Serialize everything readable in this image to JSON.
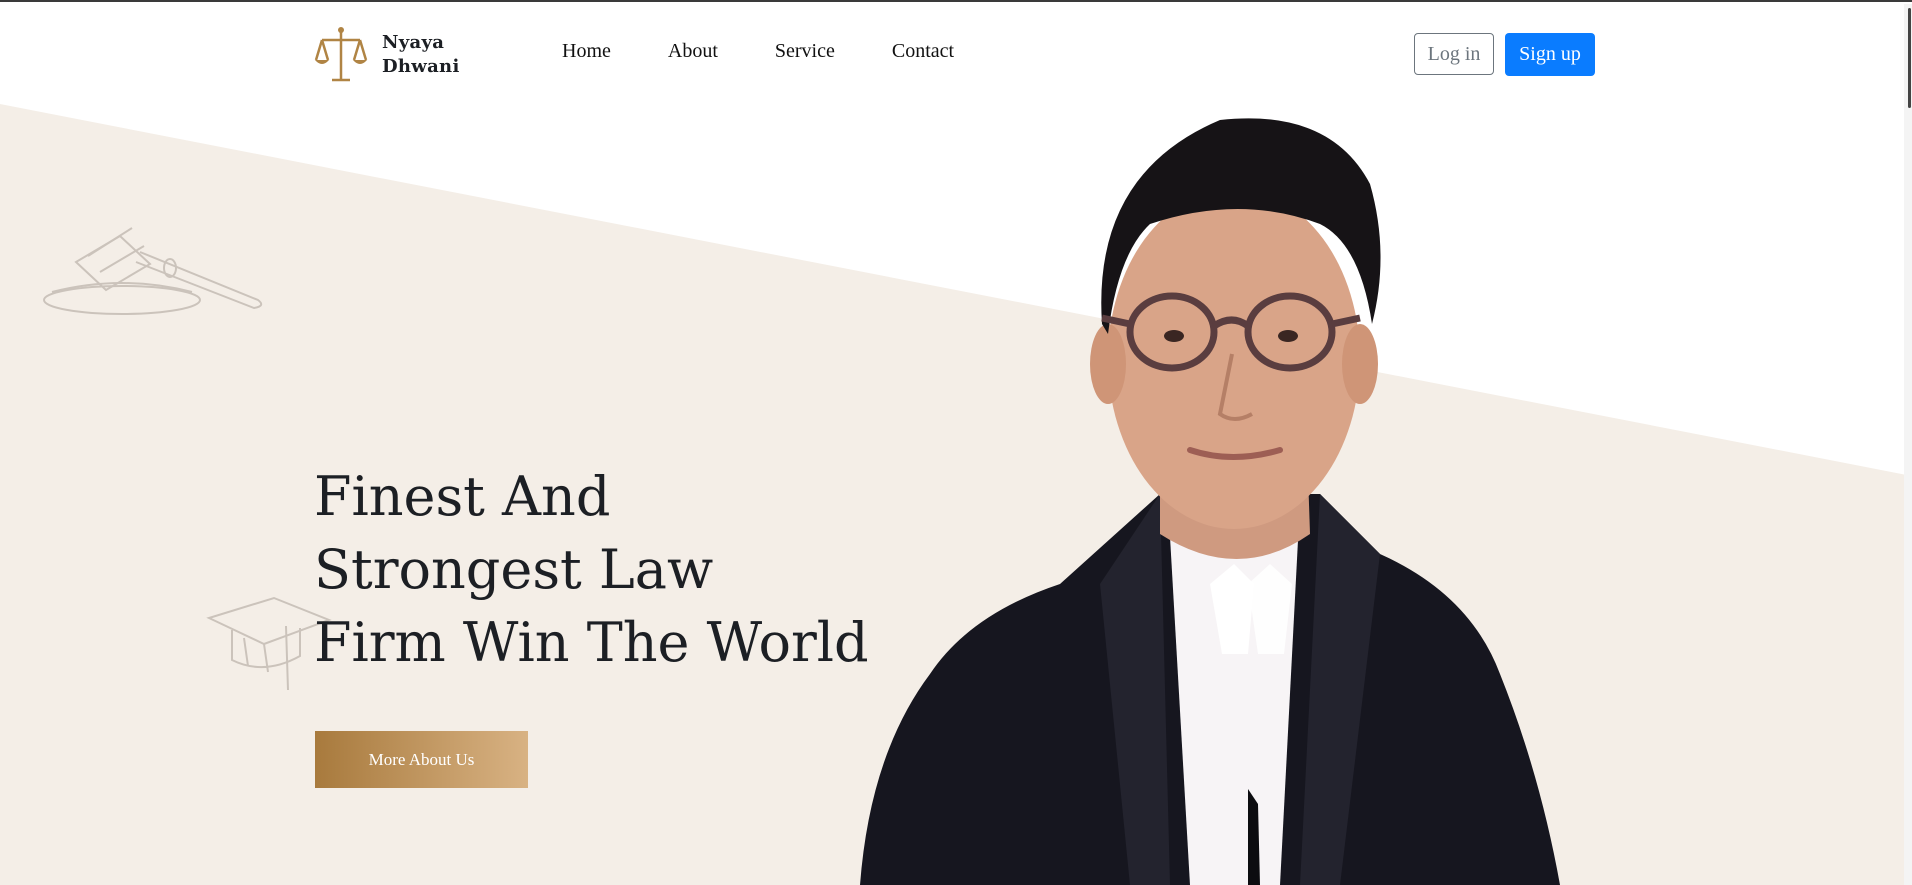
{
  "brand": {
    "line1": "Nyaya",
    "line2": "Dhwani",
    "logo_icon": "scales-of-justice-icon",
    "accent": "#b08444"
  },
  "nav": {
    "items": [
      {
        "label": "Home"
      },
      {
        "label": "About"
      },
      {
        "label": "Service"
      },
      {
        "label": "Contact"
      }
    ]
  },
  "auth": {
    "login_label": "Log in",
    "signup_label": "Sign up",
    "signup_color": "#0a7cff"
  },
  "hero": {
    "title_lines": [
      "Finest And",
      "Strongest Law",
      "Firm Win The World"
    ],
    "cta_label": "More About Us",
    "background": "#f4eee7",
    "cta_gradient": [
      "#a87a3d",
      "#d8b283"
    ]
  },
  "decorations": {
    "icons": [
      "gavel-icon",
      "graduation-cap-icon"
    ]
  }
}
